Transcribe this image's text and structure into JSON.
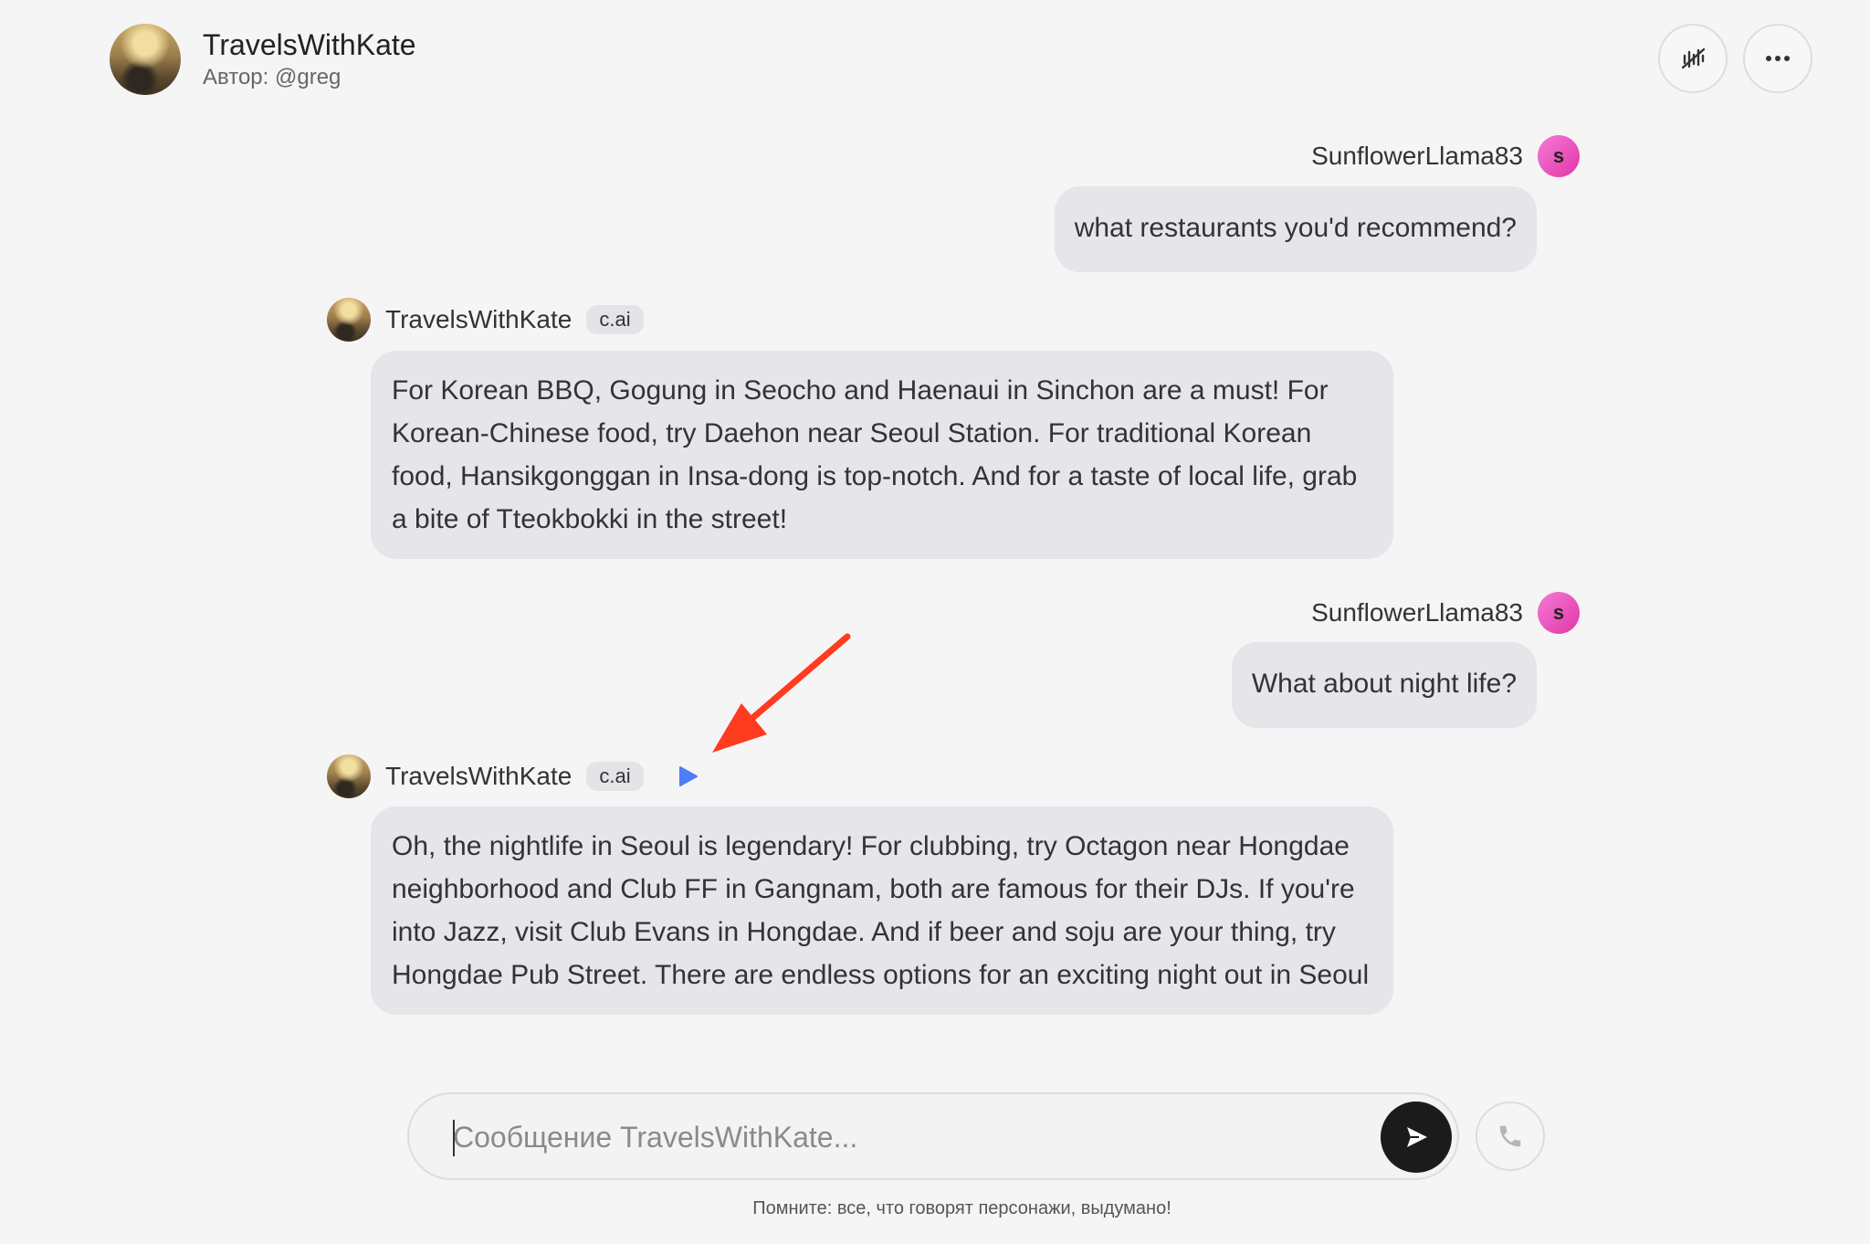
{
  "header": {
    "title": "TravelsWithKate",
    "author": "Автор: @greg"
  },
  "messages": [
    {
      "role": "user",
      "name": "SunflowerLlama83",
      "initial": "s",
      "text": "what restaurants you'd recommend?"
    },
    {
      "role": "bot",
      "name": "TravelsWithKate",
      "badge": "c.ai",
      "text": "For Korean BBQ, Gogung in Seocho and Haenaui in Sinchon are a must! For Korean-Chinese food, try Daehon near Seoul Station. For traditional Korean food, Hansikgonggan in Insa-dong is top-notch. And for a taste of local life, grab a bite of Tteokbokki in the street!"
    },
    {
      "role": "user",
      "name": "SunflowerLlama83",
      "initial": "s",
      "text": "What about night life?"
    },
    {
      "role": "bot",
      "name": "TravelsWithKate",
      "badge": "c.ai",
      "text": "Oh, the nightlife in Seoul is legendary! For clubbing, try Octagon near Hongdae neighborhood and Club FF in Gangnam, both are famous for their DJs. If you're into Jazz, visit Club Evans in Hongdae. And if beer and soju are your thing, try Hongdae Pub Street. There are endless options for an exciting night out in Seoul"
    }
  ],
  "composer": {
    "placeholder": "Сообщение TravelsWithKate..."
  },
  "disclaimer": "Помните: все, что говорят персонажи, выдумано!",
  "colors": {
    "accent_play": "#4f7cf7",
    "annotation_arrow": "#ff3b20",
    "user_avatar": "#e84db8"
  }
}
